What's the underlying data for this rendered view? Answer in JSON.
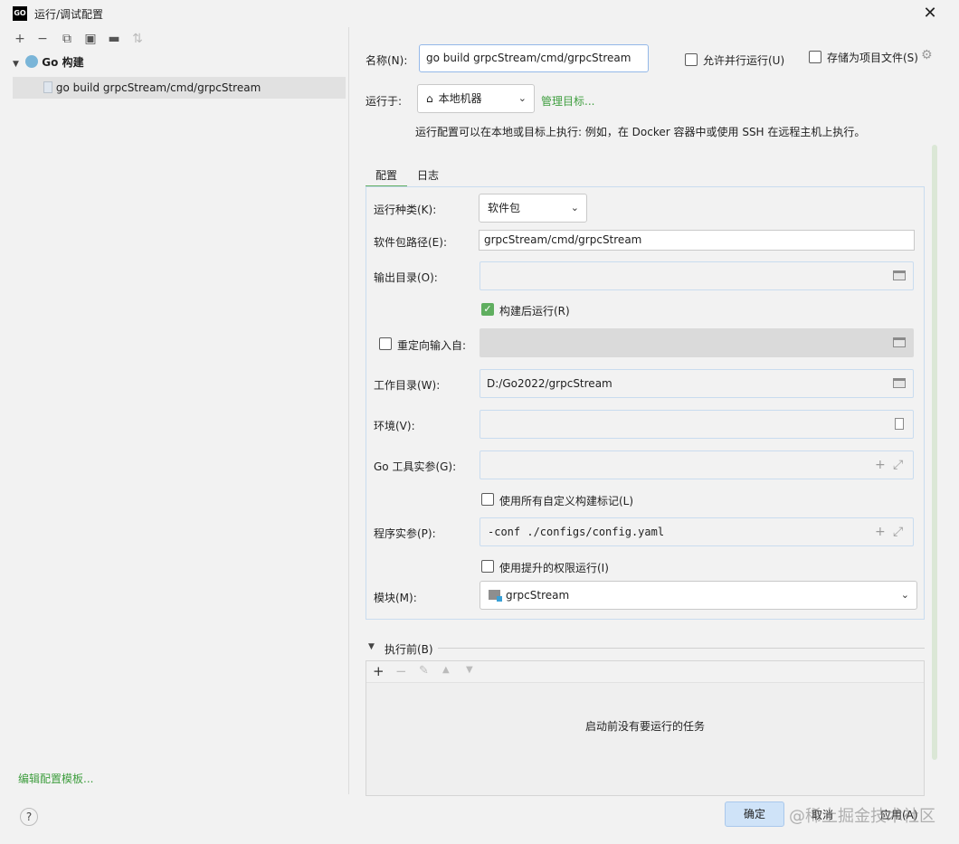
{
  "window": {
    "title": "运行/调试配置",
    "logo_text": "GO"
  },
  "left": {
    "group_label": "Go 构建",
    "item_label": "go build grpcStream/cmd/grpcStream",
    "edit_templates": "编辑配置模板..."
  },
  "header": {
    "name_label": "名称(N):",
    "name_value": "go build grpcStream/cmd/grpcStream",
    "allow_parallel": "允许并行运行(U)",
    "store_as_file": "存储为项目文件(S)",
    "run_on_label": "运行于:",
    "run_on_value": "本地机器",
    "manage_targets": "管理目标...",
    "hint": "运行配置可以在本地或目标上执行: 例如，在 Docker 容器中或使用 SSH 在远程主机上执行。"
  },
  "tabs": {
    "config": "配置",
    "log": "日志"
  },
  "form": {
    "run_kind_label": "运行种类(K):",
    "run_kind_value": "软件包",
    "package_path_label": "软件包路径(E):",
    "package_path_value": "grpcStream/cmd/grpcStream",
    "output_dir_label": "输出目录(O):",
    "run_after_build": "构建后运行(R)",
    "redirect_input": "重定向输入自:",
    "work_dir_label": "工作目录(W):",
    "work_dir_value": "D:/Go2022/grpcStream",
    "env_label": "环境(V):",
    "go_tool_args_label": "Go 工具实参(G):",
    "use_all_tags": "使用所有自定义构建标记(L)",
    "program_args_label": "程序实参(P):",
    "program_args_value": "-conf ./configs/config.yaml",
    "elevated": "使用提升的权限运行(I)",
    "module_label": "模块(M):",
    "module_value": "grpcStream"
  },
  "before": {
    "label": "执行前(B)",
    "empty": "启动前没有要运行的任务"
  },
  "buttons": {
    "ok": "确定",
    "cancel": "取消",
    "apply": "应用(A)",
    "help": "?"
  },
  "watermark": "@稀土掘金技术社区",
  "colors": {
    "link": "#3f9e3f",
    "accent_blue": "#cfe3f8",
    "checkbox_on": "#5fae5f"
  },
  "icons": [
    "add-icon",
    "remove-icon",
    "copy-icon",
    "save-icon",
    "new-folder-icon",
    "sort-icon",
    "go-build-icon",
    "file-icon",
    "home-icon",
    "folder-icon",
    "document-icon",
    "expand-icon",
    "gear-icon",
    "edit-icon",
    "up-icon",
    "down-icon"
  ]
}
